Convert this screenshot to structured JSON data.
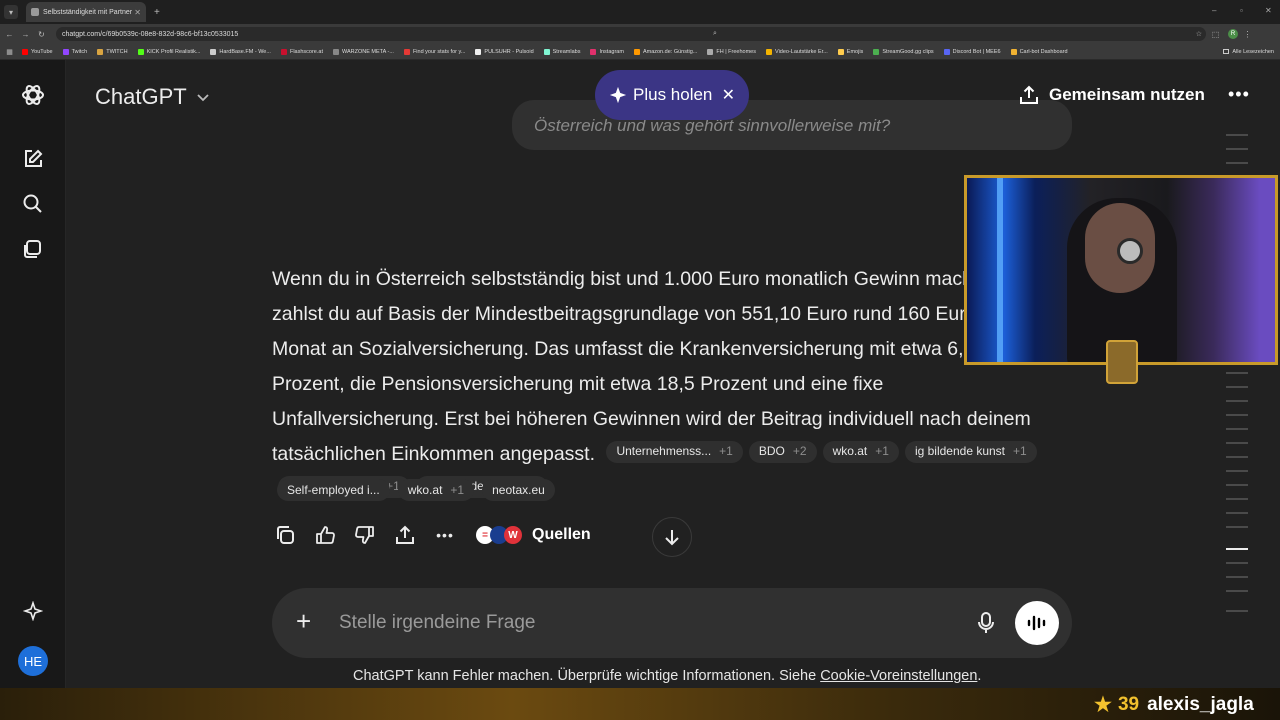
{
  "browser": {
    "tab_title": "Selbstständigkeit mit Partner",
    "url": "chatgpt.com/c/69b0539c-08e8-832d-98c6-bf13c0533015",
    "profile_initial": "R",
    "bookmarks": [
      {
        "label": "YouTube",
        "color": "#ff0000"
      },
      {
        "label": "Twitch",
        "color": "#9146ff"
      },
      {
        "label": "TWITCH",
        "color": "#d9a441"
      },
      {
        "label": "KICK Profil Realistik...",
        "color": "#53fc18"
      },
      {
        "label": "HardBase.FM - We...",
        "color": "#cccccc"
      },
      {
        "label": "Flashscore.at",
        "color": "#c8102e"
      },
      {
        "label": "WARZONE META -...",
        "color": "#888888"
      },
      {
        "label": "Find your stats for y...",
        "color": "#e53935"
      },
      {
        "label": "PULSUHR - Pulsoid",
        "color": "#eeeeee"
      },
      {
        "label": "Streamlabs",
        "color": "#80f5d2"
      },
      {
        "label": "Instagram",
        "color": "#e1306c"
      },
      {
        "label": "Amazon.de: Günstig...",
        "color": "#ff9900"
      },
      {
        "label": "FH | Freehomes",
        "color": "#aaaaaa"
      },
      {
        "label": "Video-Lautstärke Er...",
        "color": "#f4b400"
      },
      {
        "label": "Emojis",
        "color": "#ffcc4d"
      },
      {
        "label": "StreamGood.gg clips",
        "color": "#4caf50"
      },
      {
        "label": "Discord Bot | MEE6",
        "color": "#5865f2"
      },
      {
        "label": "Carl-bot Dashboard",
        "color": "#f0b232"
      }
    ],
    "all_bookmarks_label": "Alle Lesezeichen"
  },
  "header": {
    "app_title": "ChatGPT",
    "plus_label": "Plus holen",
    "share_label": "Gemeinsam nutzen"
  },
  "prev_message": "Österreich und was gehört sinnvollerweise mit?",
  "answer": {
    "text": "Wenn du in Österreich selbstständig bist und 1.000 Euro monatlich Gewinn machst, zahlst du auf Basis der Mindestbeitragsgrundlage von 551,10 Euro rund 160 Euro pro Monat an Sozialversicherung. Das umfasst die Krankenversicherung mit etwa 6,8 Prozent, die Pensionsversicherung mit etwa 18,5 Prozent und eine fixe Unfallversicherung. Erst bei höheren Gewinnen wird der Beitrag individuell nach deinem tatsächlichen Einkommen angepasst.",
    "inline_chips": [
      {
        "label": "Unternehmenss...",
        "count": "+1"
      },
      {
        "label": "BDO",
        "count": "+2"
      },
      {
        "label": "wko.at",
        "count": "+1"
      },
      {
        "label": "ig bildende kunst",
        "count": "+1"
      },
      {
        "label": "ig bildende kunst",
        "count": "+1"
      },
      {
        "label": "ig bildende kunst",
        "count": "+1"
      }
    ],
    "chips_row2": [
      {
        "label": "Self-employed i...",
        "count": ""
      },
      {
        "label": "wko.at",
        "count": "+1"
      },
      {
        "label": "neotax.eu",
        "count": ""
      }
    ]
  },
  "actions": {
    "sources_label": "Quellen"
  },
  "composer": {
    "placeholder": "Stelle irgendeine Frage"
  },
  "footer": {
    "disclaimer": "ChatGPT kann Fehler machen. Überprüfe wichtige Informationen. Siehe ",
    "link": "Cookie-Voreinstellungen",
    "period": "."
  },
  "sidebar": {
    "avatar_initials": "HE"
  },
  "stream_overlay": {
    "viewer_count": "39",
    "viewer_name": "alexis_jagla"
  },
  "colors": {
    "accent_plus": "#3b3585",
    "avatar": "#1e6fd9",
    "overlay_gold": "#c89a2a"
  }
}
